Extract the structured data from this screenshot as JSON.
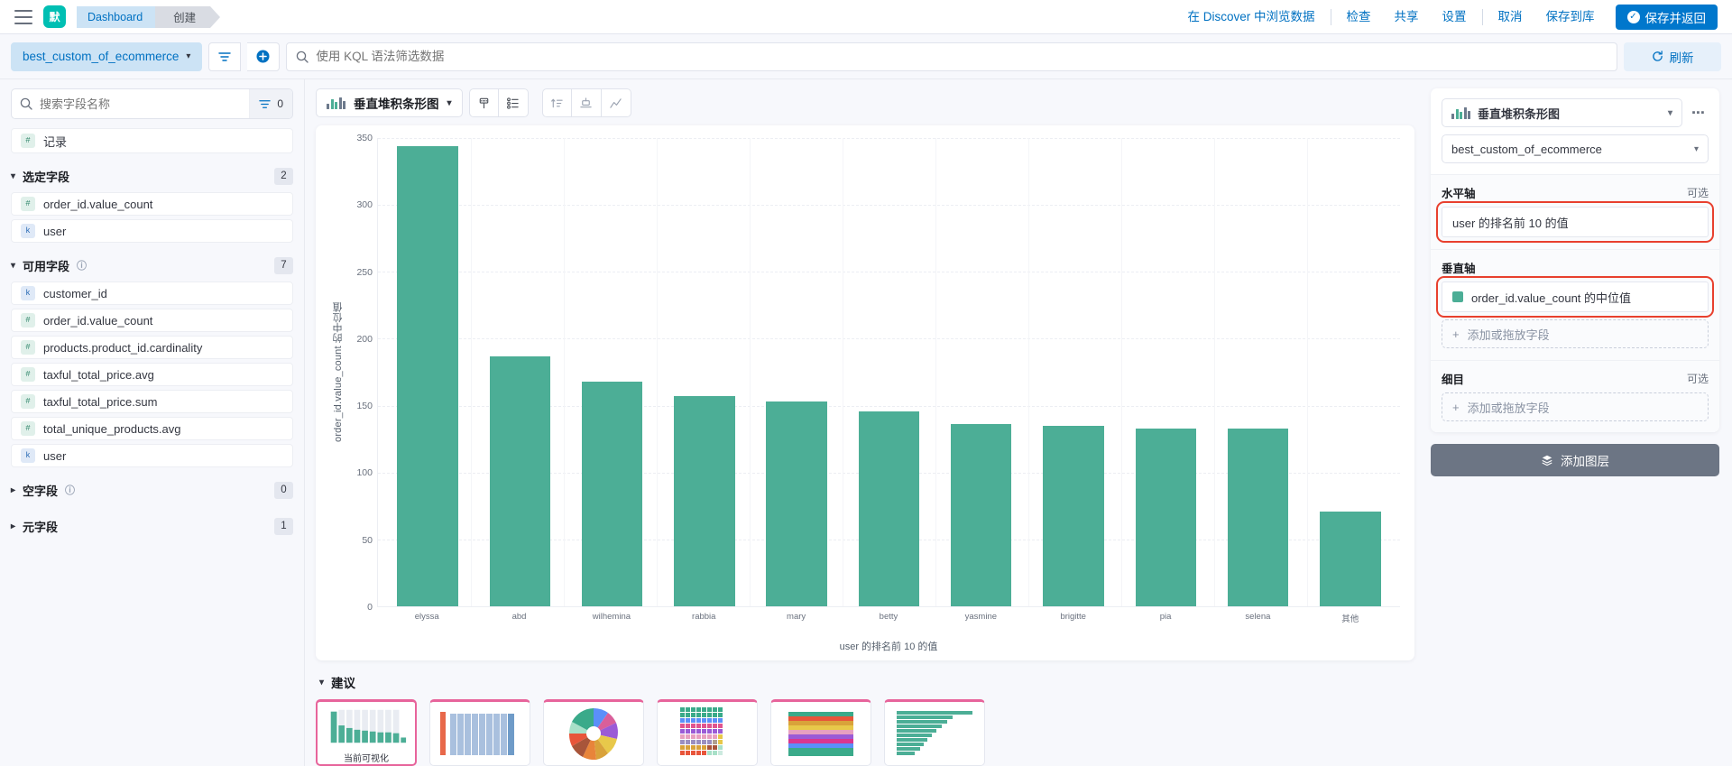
{
  "header": {
    "logo_text": "默",
    "breadcrumb_1": "Dashboard",
    "breadcrumb_2": "创建",
    "links": [
      {
        "label": "在 Discover 中浏览数据",
        "name": "explore-in-discover-link"
      },
      {
        "label": "检查",
        "name": "inspect-link"
      },
      {
        "label": "共享",
        "name": "share-link"
      },
      {
        "label": "设置",
        "name": "settings-link"
      },
      {
        "label": "取消",
        "name": "cancel-link"
      },
      {
        "label": "保存到库",
        "name": "save-to-library-link"
      }
    ],
    "save_return_label": "保存并返回"
  },
  "querybar": {
    "datasource": "best_custom_of_ecommerce",
    "kql_placeholder": "使用 KQL 语法筛选数据",
    "refresh_label": "刷新"
  },
  "sidebar": {
    "search_placeholder": "搜索字段名称",
    "filter_count": "0",
    "records_label": "记录",
    "records_type": "number",
    "selected_section": {
      "label": "选定字段",
      "count": "2"
    },
    "selected_fields": [
      {
        "name": "order_id.value_count",
        "type": "number"
      },
      {
        "name": "user",
        "type": "string"
      }
    ],
    "available_section": {
      "label": "可用字段",
      "count": "7"
    },
    "available_fields": [
      {
        "name": "customer_id",
        "type": "string"
      },
      {
        "name": "order_id.value_count",
        "type": "number"
      },
      {
        "name": "products.product_id.cardinality",
        "type": "number"
      },
      {
        "name": "taxful_total_price.avg",
        "type": "number"
      },
      {
        "name": "taxful_total_price.sum",
        "type": "number"
      },
      {
        "name": "total_unique_products.avg",
        "type": "number"
      },
      {
        "name": "user",
        "type": "string"
      }
    ],
    "empty_section": {
      "label": "空字段",
      "count": "0"
    },
    "meta_section": {
      "label": "元字段",
      "count": "1"
    }
  },
  "toolbar": {
    "chart_type": "垂直堆积条形图"
  },
  "chart_data": {
    "type": "bar",
    "title": "",
    "categories": [
      "elyssa",
      "abd",
      "wilhemina",
      "rabbia",
      "mary",
      "betty",
      "yasmine",
      "brigitte",
      "pia",
      "selena",
      "其他"
    ],
    "values": [
      344,
      187,
      168,
      157,
      153,
      146,
      136,
      135,
      133,
      133,
      71
    ],
    "xlabel": "user 的排名前 10 的值",
    "ylabel": "order_id.value_count 的中位值",
    "ylim": [
      0,
      350
    ],
    "yticks": [
      0,
      50,
      100,
      150,
      200,
      250,
      300,
      350
    ],
    "series_color": "#4cae96",
    "grid": true,
    "legend": "none"
  },
  "suggestions": {
    "title": "建议",
    "current_label": "当前可视化",
    "items": [
      {
        "name": "suggestion-current-bar"
      },
      {
        "name": "suggestion-stacked-columns"
      },
      {
        "name": "suggestion-pie"
      },
      {
        "name": "suggestion-treemap-grid"
      },
      {
        "name": "suggestion-stacked-area"
      },
      {
        "name": "suggestion-horizontal-bar"
      }
    ]
  },
  "right_panel": {
    "chart_type": "垂直堆积条形图",
    "datasource": "best_custom_of_ecommerce",
    "horizontal_axis": {
      "label": "水平轴",
      "optional": "可选",
      "value": "user 的排名前 10 的值"
    },
    "vertical_axis": {
      "label": "垂直轴",
      "value": "order_id.value_count 的中位值",
      "color": "#4cae96"
    },
    "breakdown": {
      "label": "细目",
      "optional": "可选"
    },
    "drop_placeholder": "添加或拖放字段",
    "add_layer_label": "添加图层"
  }
}
